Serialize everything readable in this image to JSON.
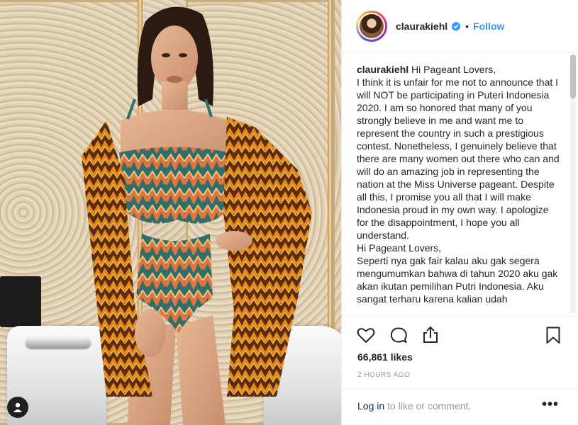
{
  "post": {
    "username": "claurakiehl",
    "follow_label": "Follow",
    "separator": "•",
    "caption_username": "claurakiehl",
    "caption_text": "Hi Pageant Lovers,\nI think it is unfair for me not to announce that I will NOT be participating in Puteri Indonesia 2020. I am so honored that many of you strongly believe in me and want me to represent the country in such a prestigious contest. Nonetheless, I genuinely believe that there are many women out there who can and will do an amazing job in representing the nation at the Miss Universe pageant. Despite all this, I promise you all that I will make Indonesia proud in my own way. I apologize for the disappointment, I hope you all understand.\nHi Pageant Lovers,\nSeperti nya gak fair kalau aku gak segera mengumumkan bahwa di tahun 2020 aku gak akan ikutan pemilihan Putri Indonesia. Aku sangat terharu karena kalian udah",
    "likes": "66,861 likes",
    "timestamp": "2 HOURS AGO",
    "login_link": "Log in",
    "login_rest": " to like or comment.",
    "more_label": "•••"
  },
  "icons": {
    "verified": "verified-badge-icon",
    "like": "heart-icon",
    "comment": "comment-bubble-icon",
    "share": "share-icon",
    "save": "bookmark-icon",
    "user_badge": "user-tag-icon"
  },
  "colors": {
    "link_blue": "#3897f0",
    "login_link": "#003569",
    "muted": "#999999",
    "text": "#262626"
  }
}
